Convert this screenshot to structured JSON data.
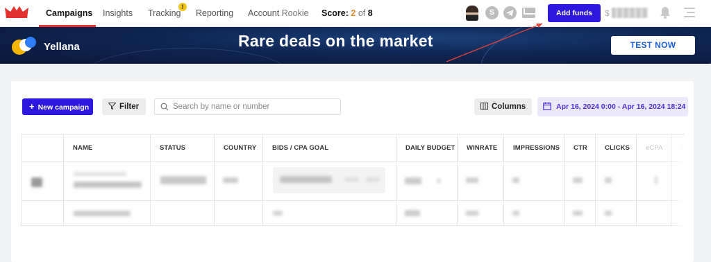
{
  "nav": {
    "items": [
      {
        "label": "Campaigns"
      },
      {
        "label": "Insights"
      },
      {
        "label": "Tracking"
      },
      {
        "label": "Reporting"
      },
      {
        "label": "Account"
      }
    ],
    "account_level": "Rookie",
    "tracking_badge": "!",
    "score_label": "Score:",
    "score_current": "2",
    "score_of": "of",
    "score_max": "8",
    "add_funds_label": "Add funds",
    "balance_prefix": "$",
    "icons": [
      "avatar",
      "skype-icon",
      "telegram-icon",
      "mail-icon",
      "bell-icon",
      "menu-icon"
    ]
  },
  "banner": {
    "brand": "Yellana",
    "title": "Rare deals on the market",
    "cta": "TEST NOW"
  },
  "toolbar": {
    "new_campaign_label": "New campaign",
    "filter_label": "Filter",
    "search_placeholder": "Search by name or number",
    "columns_label": "Columns",
    "date_range": "Apr 16, 2024 0:00 - Apr 16, 2024 18:24"
  },
  "table": {
    "headers": [
      "NAME",
      "STATUS",
      "COUNTRY",
      "BIDS / CPA GOAL",
      "DAILY BUDGET",
      "WINRATE",
      "IMPRESSIONS",
      "CTR",
      "CLICKS",
      "eCPA",
      "SI"
    ]
  },
  "colors": {
    "accent": "#2d18e0",
    "nav_active_underline": "#e2322e",
    "score_current": "#e28a2a",
    "date_chip_bg": "#ece8fb",
    "date_chip_text": "#4a31d8"
  }
}
